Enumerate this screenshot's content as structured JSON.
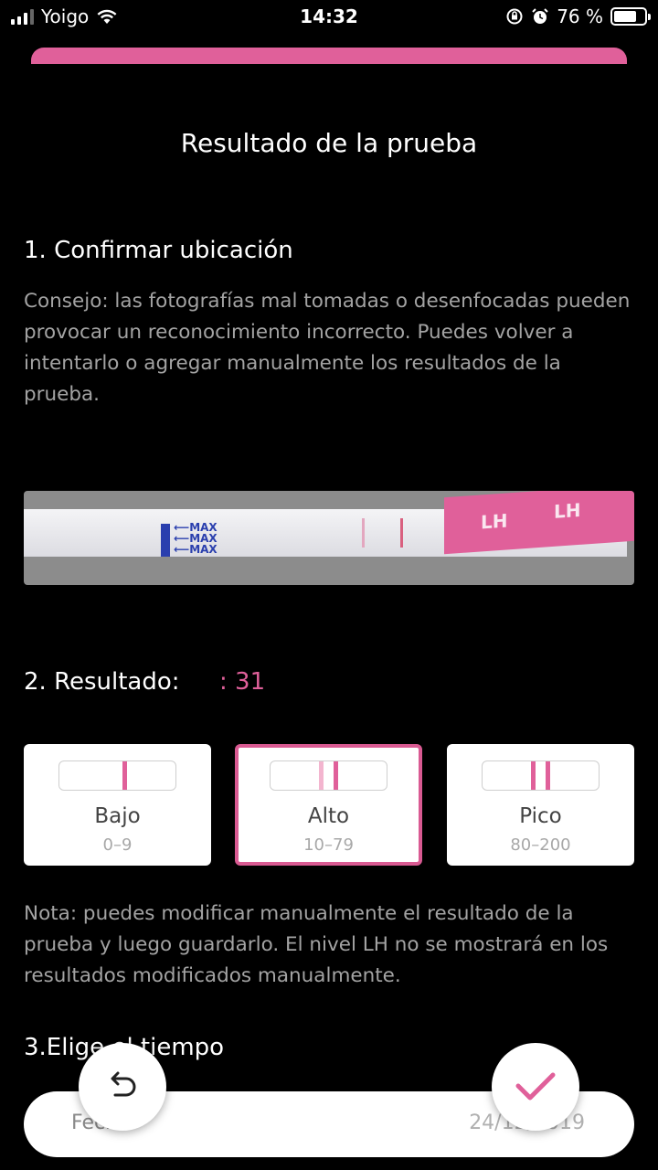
{
  "status_bar": {
    "carrier": "Yoigo",
    "time": "14:32",
    "battery_percent": "76 %",
    "battery_level": 0.76
  },
  "page": {
    "title": "Resultado de la prueba"
  },
  "section1": {
    "heading": "1. Confirmar ubicación",
    "tip": "Consejo: las fotografías mal tomadas o desenfocadas pueden provocar un reconocimiento incorrecto. Puedes volver a intentarlo o agregar manualmente los resultados de la prueba."
  },
  "strip_photo": {
    "max_text": [
      "MAX",
      "MAX",
      "MAX"
    ],
    "label_text": "LH"
  },
  "section2": {
    "heading": "2. Resultado:",
    "value": ": 31",
    "levels": [
      {
        "name": "Bajo",
        "range": "0–9",
        "selected": false
      },
      {
        "name": "Alto",
        "range": "10–79",
        "selected": true
      },
      {
        "name": "Pico",
        "range": "80–200",
        "selected": false
      }
    ],
    "note": "Nota: puedes modificar manualmente el resultado de la prueba y luego guardarlo. El nivel LH no se mostrará en los resultados modificados manualmente."
  },
  "section3": {
    "heading": "3.Elige el tiempo",
    "date_label": "Fecha",
    "date_value": "24/12/2019"
  },
  "actions": {
    "back_icon": "undo-icon",
    "confirm_icon": "check-icon"
  },
  "colors": {
    "accent": "#e0609a",
    "background": "#000000",
    "card": "#ffffff"
  }
}
